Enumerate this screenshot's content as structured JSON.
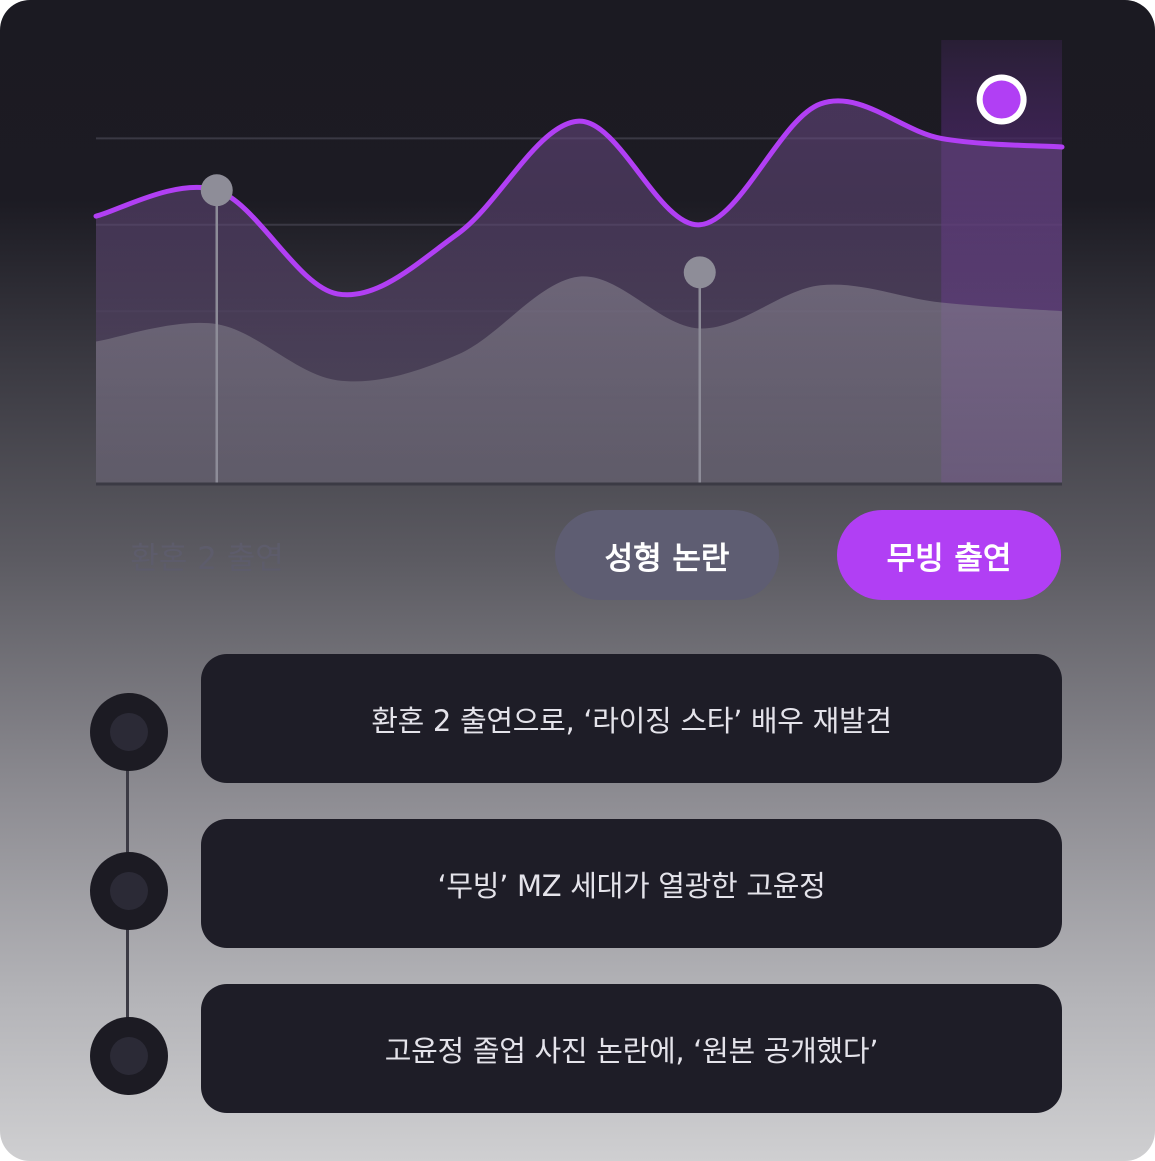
{
  "chart_data": {
    "type": "area",
    "x": [
      0,
      1,
      2,
      3,
      4,
      5,
      6,
      7,
      8
    ],
    "series": [
      {
        "values": [
          62,
          68,
          44,
          58,
          84,
          60,
          88,
          80,
          78
        ],
        "color": "#b13ff4"
      },
      {
        "values": [
          33,
          37,
          24,
          30,
          48,
          36,
          46,
          42,
          40
        ],
        "color": "#8a8a96"
      }
    ],
    "markers": [
      {
        "x": 1,
        "y": 68
      },
      {
        "x": 5,
        "y": 49
      },
      {
        "x": 7.5,
        "y": 89
      }
    ],
    "highlight_band": [
      7,
      8
    ],
    "ylim": [
      0,
      100
    ],
    "grid": true
  },
  "tags": {
    "ghost": "환혼 2 출연",
    "mid": "성형 논란",
    "active": "무빙 출연"
  },
  "timeline": [
    {
      "text": "환혼 2 출연으로, ‘라이징 스타’ 배우 재발견"
    },
    {
      "text": "‘무빙’ MZ 세대가 열광한 고윤정"
    },
    {
      "text": "고윤정 졸업 사진 논란에, ‘원본 공개했다’"
    }
  ],
  "colors": {
    "accent": "#b13ff4",
    "muted_pill": "#5e5d72",
    "card": "#1e1d27"
  }
}
